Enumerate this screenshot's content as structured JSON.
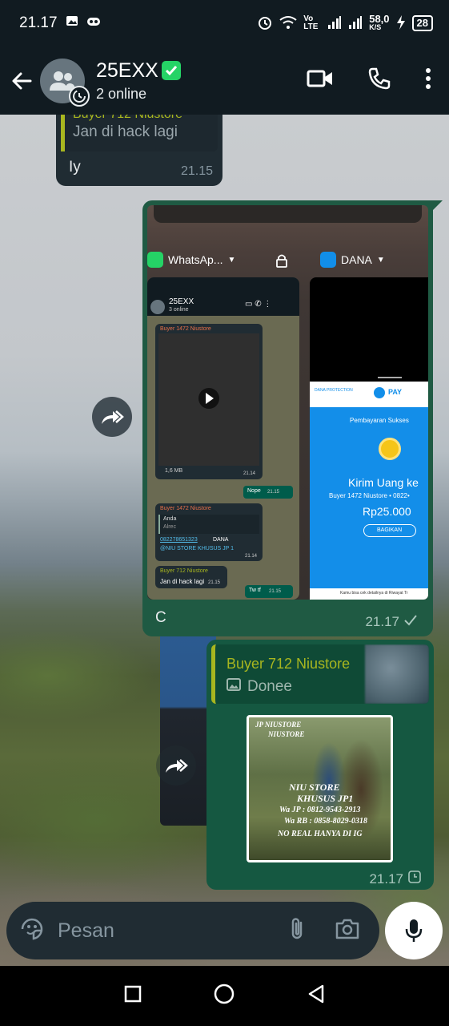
{
  "status_bar": {
    "time": "21.17",
    "net_speed": "58,0",
    "net_unit": "K/S",
    "battery": "28",
    "volte": "Vo LTE"
  },
  "header": {
    "title": "25EXX",
    "subtitle": "2 online"
  },
  "messages": [
    {
      "direction": "in",
      "quoted_name": "Buyer 712 Niustore",
      "quoted_text": "Jan di hack lagi",
      "text": "Iy",
      "time": "21.15"
    },
    {
      "direction": "out",
      "caption": "C",
      "time": "21.17",
      "screenshot": {
        "left_app": "WhatsAp...",
        "right_app": "DANA",
        "inner_chat": {
          "title": "25EXX",
          "subtitle": "3 online",
          "msg_sender": "Buyer 1472 Niustore",
          "video_size": "1,6 MB",
          "video_time": "21.14",
          "reply1_text": "Nope",
          "reply1_time": "21.15",
          "msg2_sender": "Buyer 1472 Niustore",
          "quote_name": "Anda",
          "quote_text": "Alrec",
          "phone": "082278651323",
          "phone_suffix": "DANA",
          "store_text": "@NIU STORE KHUSUS JP 1",
          "msg2_time": "21.14",
          "msg3_sender": "Buyer 712 Niustore",
          "msg3_text": "Jan di hack lagi",
          "msg3_time": "21.15",
          "reply2_text": "Tw tf",
          "reply2_time": "21.15"
        },
        "dana": {
          "protection": "DANA PROTECTION",
          "pay": "PAY",
          "status": "Pembayaran Sukses",
          "headline": "Kirim Uang ke",
          "recipient": "Buyer 1472 Niustore • 0822•",
          "amount": "Rp25.000",
          "share": "BAGIKAN",
          "footer": "Kamu bisa cek detailnya di Riwayat Tr"
        }
      }
    },
    {
      "direction": "out",
      "reply_name": "Buyer 712 Niustore",
      "reply_text": "Donee",
      "time": "21.17",
      "promo": {
        "line1": "JP NIUSTORE",
        "line2": "NIUSTORE",
        "line3": "NIU STORE",
        "line4": "KHUSUS JP1",
        "line5": "Wa JP : 0812-9543-2913",
        "line6": "Wa RB : 0858-8029-0318",
        "line7": "NO REAL HANYA DI IG"
      }
    }
  ],
  "composer": {
    "placeholder": "Pesan"
  },
  "colors": {
    "header_bg": "#111b21",
    "bubble_out": "#005c4b",
    "bubble_in": "#202c33",
    "quote_accent": "#a8b61f",
    "verified": "#25d366"
  }
}
